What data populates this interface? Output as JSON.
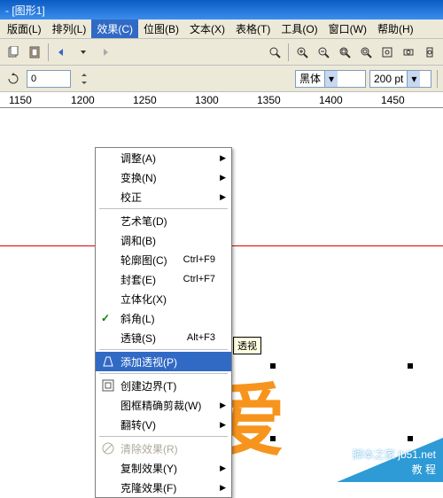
{
  "title": "- [图形1]",
  "menubar": [
    "版面(L)",
    "排列(L)",
    "效果(C)",
    "位图(B)",
    "文本(X)",
    "表格(T)",
    "工具(O)",
    "窗口(W)",
    "帮助(H)"
  ],
  "active_menu_index": 2,
  "toolbar2": {
    "angle": "0",
    "font": "黑体",
    "size": "200 pt"
  },
  "ruler": {
    "marks": [
      "1150",
      "1200",
      "1250",
      "1300",
      "1350",
      "1400",
      "1450"
    ]
  },
  "dropdown": {
    "items": [
      {
        "label": "调整(A)",
        "arrow": true
      },
      {
        "label": "变换(N)",
        "arrow": true
      },
      {
        "label": "校正",
        "arrow": true
      },
      {
        "sep": true
      },
      {
        "label": "艺术笔(D)"
      },
      {
        "label": "调和(B)"
      },
      {
        "label": "轮廓图(C)",
        "shortcut": "Ctrl+F9"
      },
      {
        "label": "封套(E)",
        "shortcut": "Ctrl+F7"
      },
      {
        "label": "立体化(X)"
      },
      {
        "label": "斜角(L)",
        "check": true
      },
      {
        "label": "透镜(S)",
        "shortcut": "Alt+F3"
      },
      {
        "sep": true
      },
      {
        "label": "添加透视(P)",
        "hover": true,
        "icon": "perspective"
      },
      {
        "sep": true
      },
      {
        "label": "创建边界(T)",
        "icon": "boundary"
      },
      {
        "label": "图框精确剪裁(W)",
        "arrow": true
      },
      {
        "label": "翻转(V)",
        "arrow": true
      },
      {
        "sep": true
      },
      {
        "label": "清除效果(R)",
        "disabled": true,
        "icon": "clear"
      },
      {
        "label": "复制效果(Y)",
        "arrow": true
      },
      {
        "label": "克隆效果(F)",
        "arrow": true
      }
    ]
  },
  "tooltip": "透视",
  "art_text": "三爱",
  "watermark": {
    "line1": "脚本之家 jb51.net",
    "line2": "教    程"
  }
}
